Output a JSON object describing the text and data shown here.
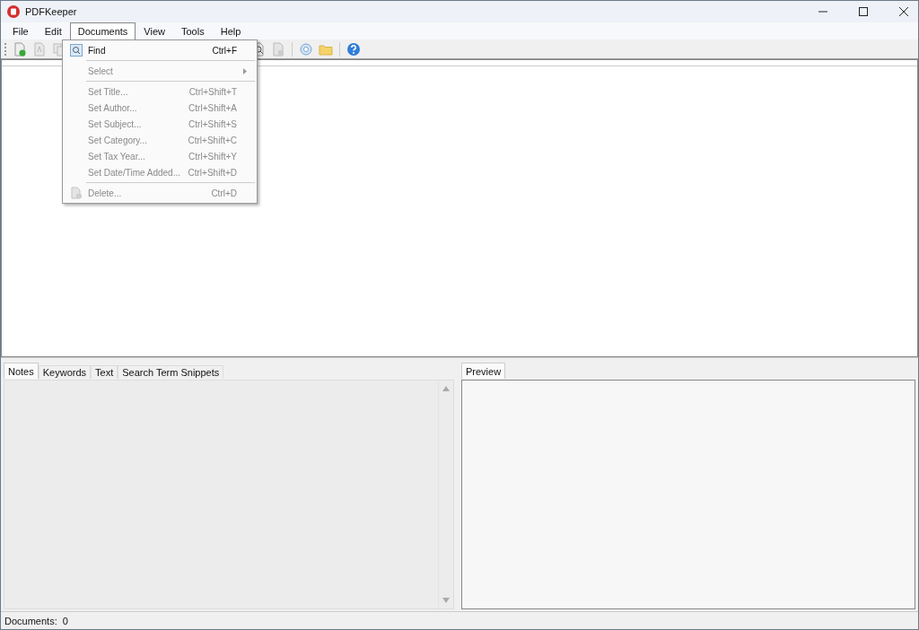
{
  "window": {
    "title": "PDFKeeper"
  },
  "menu_bar": [
    {
      "label": "File",
      "selected": false
    },
    {
      "label": "Edit",
      "selected": false
    },
    {
      "label": "Documents",
      "selected": true
    },
    {
      "label": "View",
      "selected": false
    },
    {
      "label": "Tools",
      "selected": false
    },
    {
      "label": "Help",
      "selected": false
    }
  ],
  "documents_menu": [
    {
      "kind": "item",
      "label": "Find",
      "shortcut": "Ctrl+F",
      "disabled": false
    },
    {
      "kind": "separator"
    },
    {
      "kind": "submenu",
      "label": "Select",
      "disabled": true
    },
    {
      "kind": "separator"
    },
    {
      "kind": "item",
      "label": "Set Title...",
      "shortcut": "Ctrl+Shift+T",
      "disabled": true
    },
    {
      "kind": "item",
      "label": "Set Author...",
      "shortcut": "Ctrl+Shift+A",
      "disabled": true
    },
    {
      "kind": "item",
      "label": "Set Subject...",
      "shortcut": "Ctrl+Shift+S",
      "disabled": true
    },
    {
      "kind": "item",
      "label": "Set Category...",
      "shortcut": "Ctrl+Shift+C",
      "disabled": true
    },
    {
      "kind": "item",
      "label": "Set Tax Year...",
      "shortcut": "Ctrl+Shift+Y",
      "disabled": true
    },
    {
      "kind": "item",
      "label": "Set Date/Time Added...",
      "shortcut": "Ctrl+Shift+D",
      "disabled": true
    },
    {
      "kind": "separator"
    },
    {
      "kind": "item",
      "label": "Delete...",
      "shortcut": "Ctrl+D",
      "disabled": true
    }
  ],
  "details_tabs": [
    {
      "label": "Notes",
      "selected": true
    },
    {
      "label": "Keywords",
      "selected": false
    },
    {
      "label": "Text",
      "selected": false
    },
    {
      "label": "Search Term Snippets",
      "selected": false
    }
  ],
  "preview_tabs": [
    {
      "label": "Preview",
      "selected": true
    }
  ],
  "status_bar": {
    "text": "Documents:  0"
  }
}
